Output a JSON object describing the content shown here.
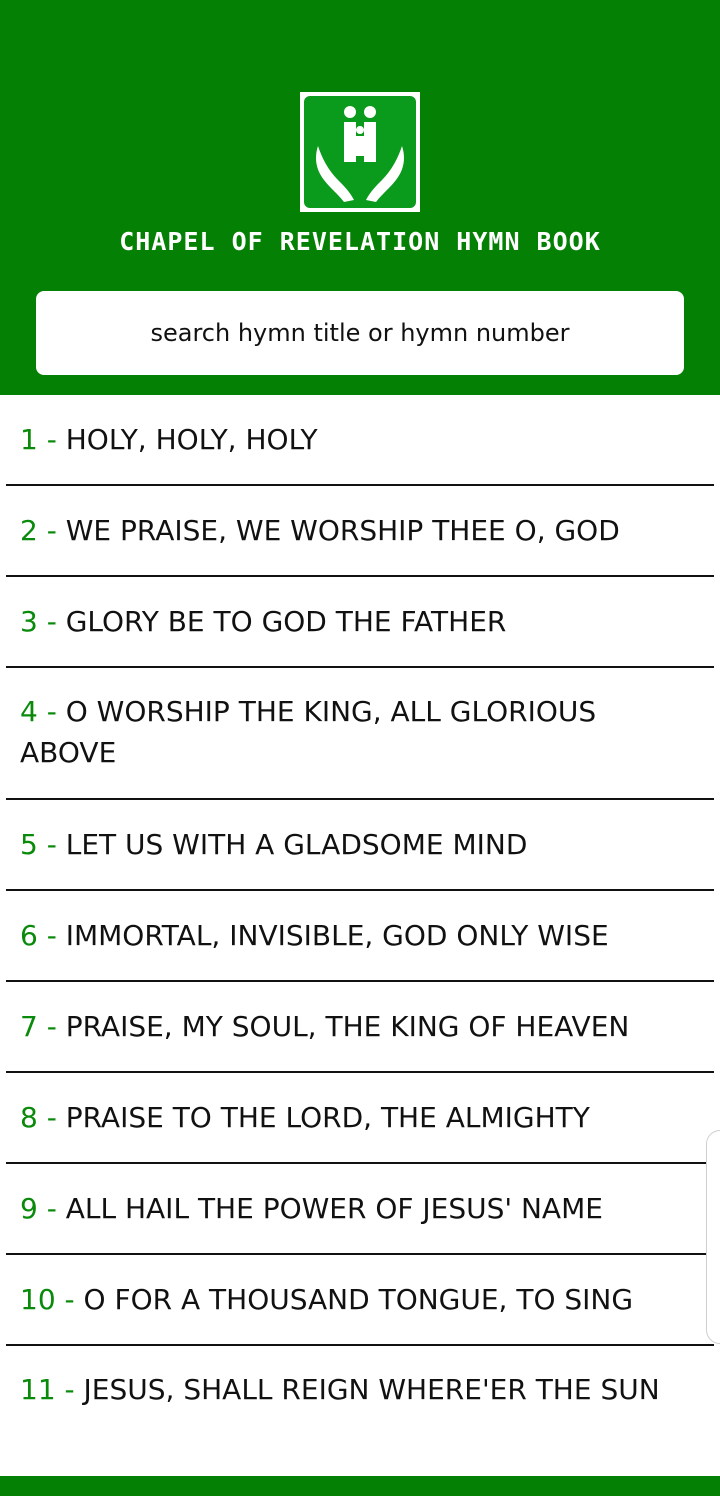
{
  "header": {
    "title": "CHAPEL OF REVELATION HYMN BOOK",
    "logo_icon": "praying-hands-family-logo-icon",
    "background_color": "#048004"
  },
  "search": {
    "placeholder": "search hymn title or hymn number",
    "value": ""
  },
  "colors": {
    "accent": "#048004",
    "number_color": "#0a8a0a",
    "text_color": "#111111"
  },
  "hymns": [
    {
      "number": "1 - ",
      "title": "HOLY, HOLY, HOLY"
    },
    {
      "number": "2 - ",
      "title": "WE PRAISE, WE WORSHIP THEE O, GOD"
    },
    {
      "number": "3 - ",
      "title": "GLORY BE TO GOD THE FATHER"
    },
    {
      "number": "4 - ",
      "title": "O WORSHIP THE KING, ALL GLORIOUS ABOVE"
    },
    {
      "number": "5 - ",
      "title": "LET US WITH A GLADSOME MIND"
    },
    {
      "number": "6 - ",
      "title": "IMMORTAL, INVISIBLE, GOD ONLY WISE"
    },
    {
      "number": "7 - ",
      "title": "PRAISE, MY SOUL, THE KING OF HEAVEN"
    },
    {
      "number": "8 - ",
      "title": "PRAISE TO THE LORD, THE ALMIGHTY"
    },
    {
      "number": "9 - ",
      "title": "ALL HAIL THE POWER OF JESUS' NAME"
    },
    {
      "number": "10 - ",
      "title": "O FOR A THOUSAND TONGUE, TO SING"
    },
    {
      "number": "11 - ",
      "title": "JESUS, SHALL REIGN WHERE'ER THE SUN"
    }
  ]
}
